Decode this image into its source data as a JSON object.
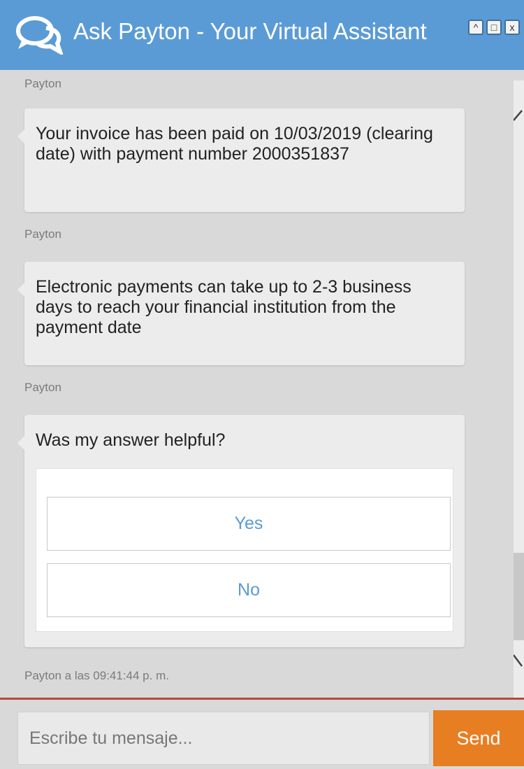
{
  "window": {
    "title": "Ask Payton - Your Virtual Assistant",
    "accent_color": "#5b9bd5",
    "controls": [
      {
        "name": "minimize",
        "icon": "chevron-up-icon",
        "glyph": "^"
      },
      {
        "name": "maximize",
        "icon": "square-icon",
        "glyph": "□"
      },
      {
        "name": "close",
        "icon": "close-icon",
        "glyph": "x"
      }
    ]
  },
  "messages": [
    {
      "sender": "Payton",
      "text": "Your invoice has been paid on 10/03/2019 (clearing date) with payment number 2000351837"
    },
    {
      "sender": "Payton",
      "text": "Electronic payments can take up to 2-3 business days to reach your financial institution from the payment date"
    },
    {
      "sender": "Payton",
      "text": "Was my answer helpful?",
      "options": [
        "Yes",
        "No"
      ]
    }
  ],
  "last_timestamp": "Payton a las 09:41:44 p. m.",
  "composer": {
    "placeholder": "Escribe tu mensaje...",
    "send_label": "Send",
    "send_color": "#e87e22"
  }
}
